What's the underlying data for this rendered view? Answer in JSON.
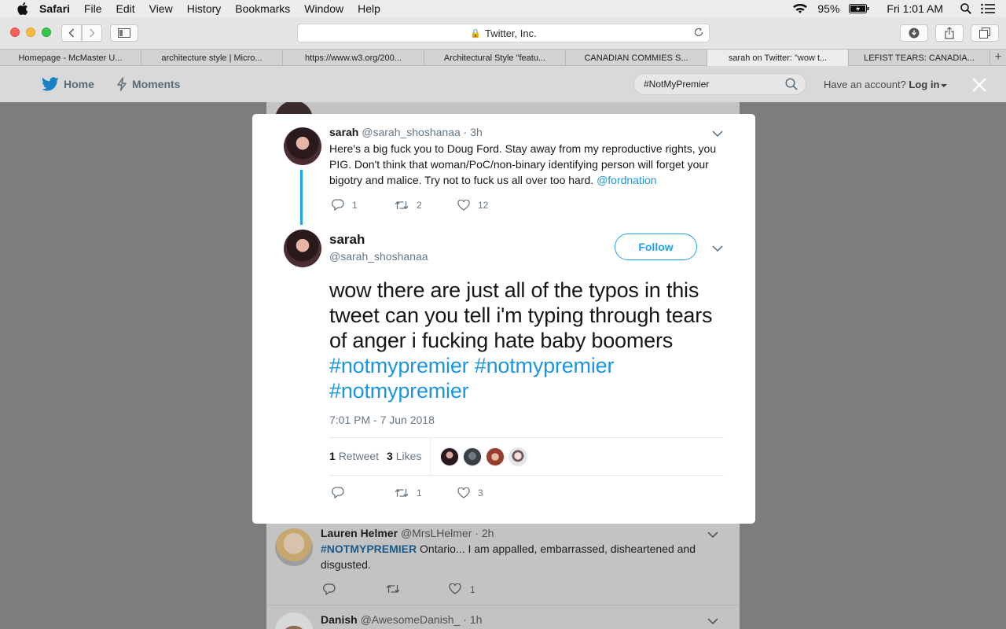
{
  "menubar": {
    "app": "Safari",
    "items": [
      "File",
      "Edit",
      "View",
      "History",
      "Bookmarks",
      "Window",
      "Help"
    ],
    "battery": "95%",
    "clock": "Fri 1:01 AM"
  },
  "toolbar": {
    "url": "Twitter, Inc."
  },
  "tabs": [
    "Homepage - McMaster U...",
    "architecture style | Micro...",
    "https://www.w3.org/200...",
    "Architectural Style \"featu...",
    "CANADIAN COMMIES S...",
    "sarah on Twitter: \"wow t...",
    "LEFIST TEARS: CANADIA..."
  ],
  "twitter_header": {
    "home": "Home",
    "moments": "Moments",
    "search_value": "#NotMyPremier",
    "account_prompt": "Have an account?",
    "login": "Log in"
  },
  "background_tweets": [
    {
      "name": "Lauren Helmer",
      "handle": "@MrsLHelmer",
      "time": "· 2h",
      "hashtag": "#NOTMYPREMIER",
      "text": " Ontario... I am appalled, embarrassed, disheartened and disgusted.",
      "likes": "1"
    },
    {
      "name": "Danish",
      "handle": "@AwesomeDanish_",
      "time": "· 1h"
    }
  ],
  "modal": {
    "parent": {
      "name": "sarah",
      "handle": "@sarah_shoshanaa",
      "time": "· 3h",
      "text": "Here's a big fuck you to Doug Ford. Stay away from my reproductive rights, you PIG. Don't think that woman/PoC/non-binary identifying person will forget your bigotry and malice. Try not to fuck us all over too hard. ",
      "mention": "@fordnation",
      "replies": "1",
      "retweets": "2",
      "likes": "12"
    },
    "main": {
      "name": "sarah",
      "handle": "@sarah_shoshanaa",
      "follow_label": "Follow",
      "text": "wow there are just all of the typos in this tweet can you tell i'm typing through tears of anger i fucking hate baby boomers ",
      "hashtags": [
        "#notmypremier",
        "#notmypremier",
        "#notmypremier"
      ],
      "timestamp": "7:01 PM - 7 Jun 2018",
      "retweet_count": "1",
      "retweet_label": "Retweet",
      "like_count": "3",
      "like_label": "Likes",
      "action_retweets": "1",
      "action_likes": "3"
    }
  },
  "colors": {
    "twitter_blue": "#1da1f2",
    "link_blue": "#1b95e0",
    "overlay": "#7d7d7d"
  }
}
